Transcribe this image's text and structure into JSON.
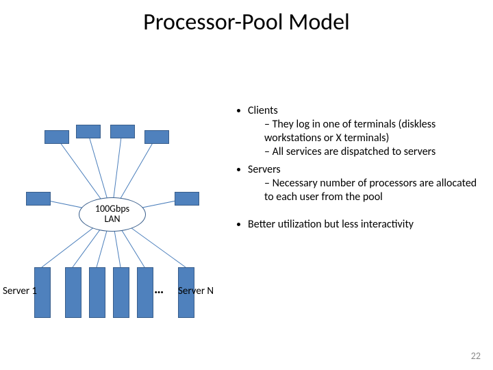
{
  "title": "Processor-Pool Model",
  "bullets": {
    "clients": {
      "label": "Clients",
      "sub1": "They log in one of terminals (diskless workstations or X terminals)",
      "sub2": "All services are dispatched to servers"
    },
    "servers": {
      "label": "Servers",
      "sub1": "Necessary number of processors are allocated to each user from the pool"
    },
    "better": "Better utilization but less interactivity"
  },
  "hub": {
    "line1": "100Gbps",
    "line2": "LAN"
  },
  "server_first": "Server 1",
  "server_last": "Server N",
  "ellipsis": "…",
  "page": "22"
}
